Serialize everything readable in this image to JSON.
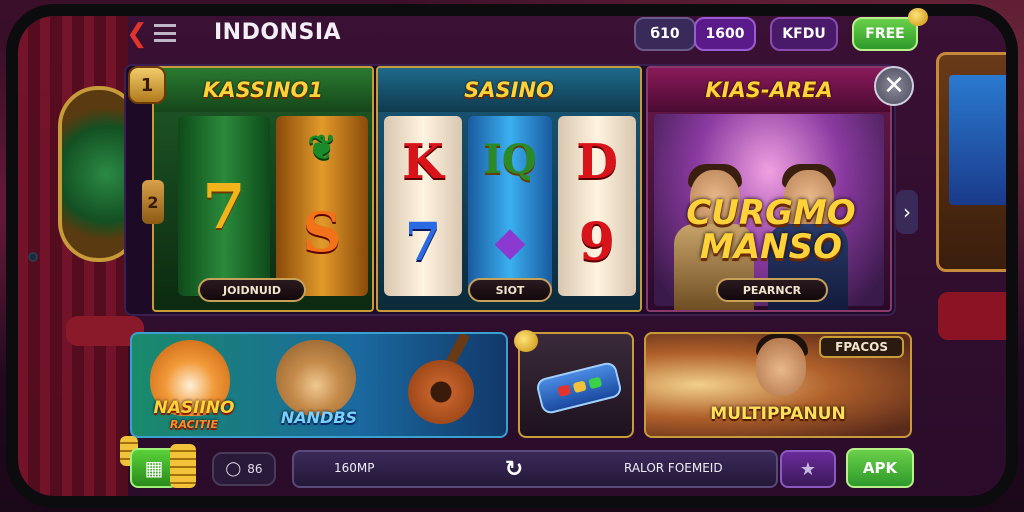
{
  "header": {
    "title": "INDONSIA",
    "pills": [
      "б10",
      "1600",
      "KFDU"
    ],
    "free_label": "FREE"
  },
  "games": [
    {
      "title": "KASSINO1",
      "symbols": [
        "7",
        "S"
      ],
      "button": "JOIDNUID"
    },
    {
      "title": "SASINO",
      "symbols_top": [
        "K",
        "IQ",
        "D"
      ],
      "symbols_bottom": [
        "7",
        "9"
      ],
      "button": "SIOT"
    },
    {
      "title": "KIAS-AREA",
      "hero_title": "CURGMO MANSO",
      "button": "PEARNCR"
    }
  ],
  "badges": {
    "corner": "1",
    "side": "2"
  },
  "promos": {
    "card_a_logo1": "NASIINO",
    "card_a_logo1_sub": "RACITIE",
    "card_a_logo2": "NANDBS",
    "card_c_tag": "FPACOS",
    "card_c_title": "MULTIPPANUN"
  },
  "bottom": {
    "balance_value": "86",
    "search_left": "160MP",
    "search_right": "RALOR FOEMEID",
    "apk_label": "APK"
  },
  "colors": {
    "accent_gold": "#ffd23a",
    "accent_green": "#2e9a2a",
    "close_red": "#e2342c"
  },
  "icons": {
    "back": "back-arrow-icon",
    "menu": "menu-icon",
    "close": "close-icon",
    "next": "chevron-right-icon",
    "home": "grid-home-icon",
    "balance": "coin-icon",
    "spin": "spin-icon",
    "favorite": "star-icon"
  }
}
